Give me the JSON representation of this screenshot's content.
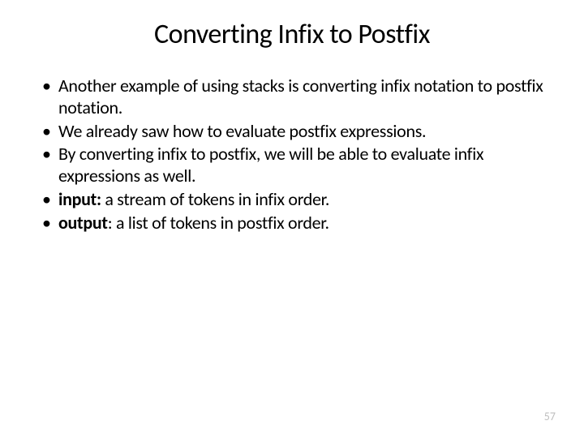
{
  "title": "Converting Infix to Postfix",
  "bullets": [
    {
      "text": "Another example of using stacks is converting infix notation to postfix notation."
    },
    {
      "text": "We already saw how to evaluate postfix expressions."
    },
    {
      "text": "By converting infix to postfix, we will be able to evaluate infix expressions as well."
    },
    {
      "label": "input:",
      "text": " a stream of tokens in infix order."
    },
    {
      "label": "output",
      "text": ": a list of tokens in postfix order."
    }
  ],
  "page_number": "57"
}
